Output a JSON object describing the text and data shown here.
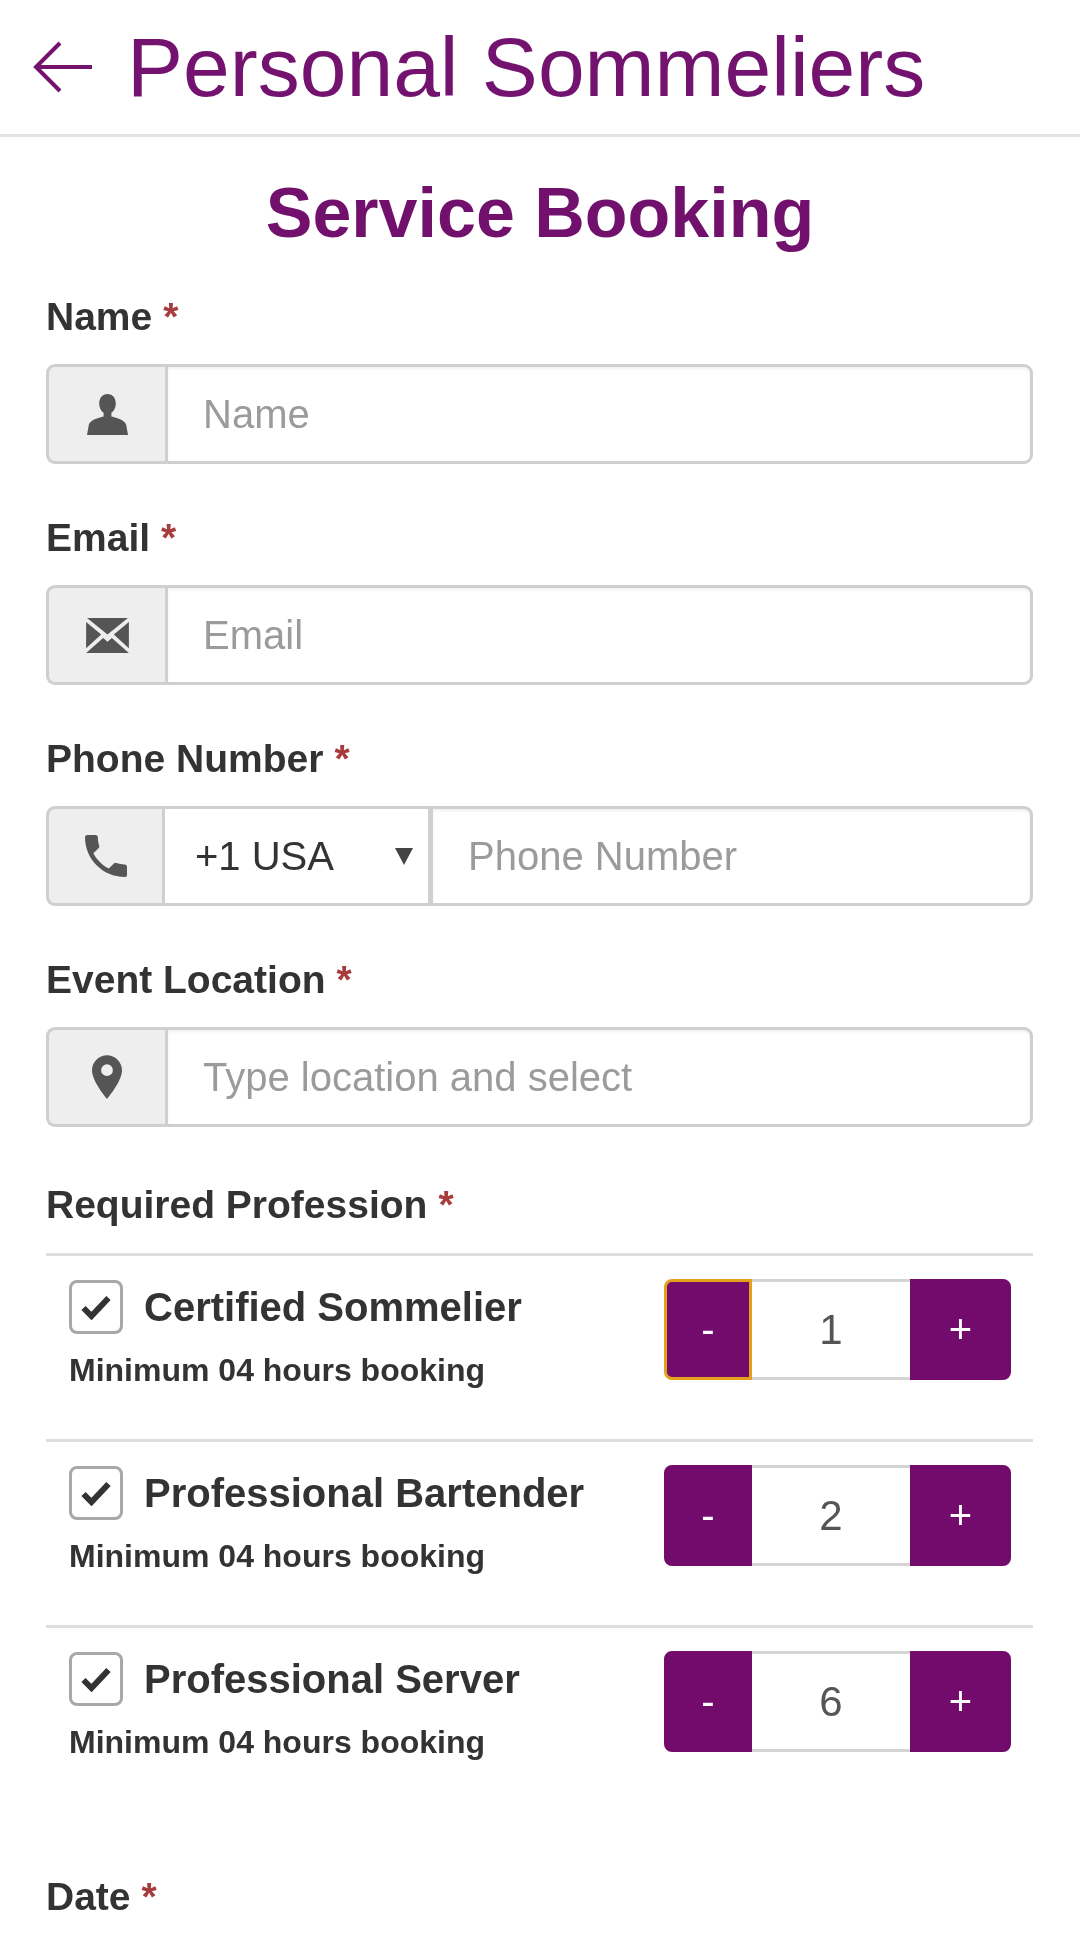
{
  "header": {
    "title": "Personal Sommeliers"
  },
  "heading": "Service Booking",
  "fields": [
    {
      "kind": "name",
      "label": "Name",
      "required_mark": "*",
      "placeholder": "Name"
    },
    {
      "kind": "email",
      "label": "Email",
      "required_mark": "*",
      "placeholder": "Email"
    },
    {
      "kind": "phone",
      "label": "Phone Number",
      "required_mark": "*",
      "country_code": "+1 USA",
      "placeholder": "Phone Number"
    },
    {
      "kind": "location",
      "label": "Event Location",
      "required_mark": "*",
      "placeholder": "Type location and select"
    }
  ],
  "profession": {
    "label": "Required Profession",
    "required_mark": "*",
    "options": [
      {
        "checked": true,
        "title": "Certified Sommelier",
        "note": "Minimum 04 hours booking",
        "decrement": {
          "label": "-",
          "focused": true
        },
        "quantity": "1",
        "increment": {
          "label": "+",
          "focused": false
        }
      },
      {
        "checked": true,
        "title": "Professional Bartender",
        "note": "Minimum 04 hours booking",
        "decrement": {
          "label": "-",
          "focused": false
        },
        "quantity": "2",
        "increment": {
          "label": "+",
          "focused": false
        }
      },
      {
        "checked": true,
        "title": "Professional Server",
        "note": "Minimum 04 hours booking",
        "decrement": {
          "label": "-",
          "focused": false
        },
        "quantity": "6",
        "increment": {
          "label": "+",
          "focused": false
        }
      }
    ]
  },
  "date": {
    "label": "Date",
    "required_mark": "*"
  }
}
